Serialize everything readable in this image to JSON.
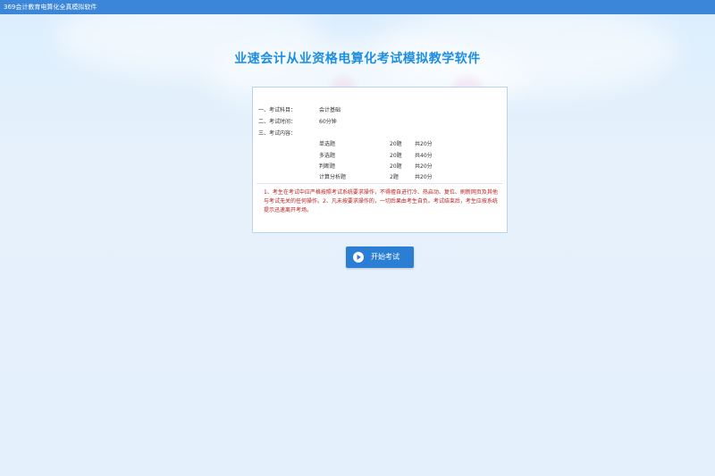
{
  "window": {
    "title": "369会计教育电算化全真模拟软件"
  },
  "header": {
    "app_title": "业速会计从业资格电算化考试模拟教学软件"
  },
  "exam_info": {
    "subject_label": "一、考试科目：",
    "subject_value": "会计基础",
    "time_label": "二、考试时间：",
    "time_value": "60分钟",
    "content_label": "三、考试内容：",
    "question_types": [
      {
        "type": "单选题",
        "count": "20题",
        "score": "共20分"
      },
      {
        "type": "多选题",
        "count": "20题",
        "score": "共40分"
      },
      {
        "type": "判断题",
        "count": "20题",
        "score": "共20分"
      },
      {
        "type": "计算分析题",
        "count": "2题",
        "score": "共20分"
      }
    ]
  },
  "notice": {
    "text": "1、考生在考试中应严格按照考试系统要求操作，不得擅自进行冷、热启动、复位、刷新网页及其他与考试无关的任何操作。2、凡未按要求操作的，一切后果由考生自负。考试结束后，考生应按系统提示迅速离开考场。"
  },
  "actions": {
    "start_label": "开始考试",
    "start_icon": "play-circle-icon"
  },
  "colors": {
    "titlebar": "#3b86d8",
    "title_text": "#1e8ee0",
    "notice_text": "#b62020",
    "button": "#2a7fd4",
    "background": "#e4f0fc"
  }
}
